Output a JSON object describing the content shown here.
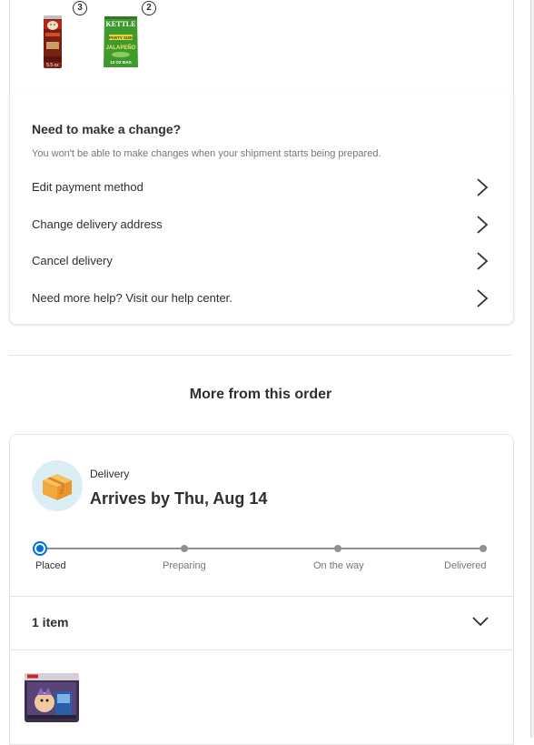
{
  "order_items": [
    {
      "name": "Pringles",
      "quantity": "3",
      "can_text": "5.5 oz"
    },
    {
      "name": "Kettle Jalapeño chips",
      "quantity": "2",
      "bag_brand": "KETTLE",
      "bag_tag": "PARTY SIZE",
      "bag_flavor": "JALAPEÑO",
      "bag_size": "13 OZ BAG"
    }
  ],
  "change": {
    "title": "Need to make a change?",
    "subtitle": "You won't be able to make changes when your shipment starts being prepared.",
    "actions": [
      {
        "label": "Edit payment method"
      },
      {
        "label": "Change delivery address"
      },
      {
        "label": "Cancel delivery"
      },
      {
        "label": "Need more help? Visit our help center."
      }
    ]
  },
  "more_section": {
    "title": "More from this order"
  },
  "delivery": {
    "type_label": "Delivery",
    "arrival": "Arrives by Thu, Aug 14",
    "steps": [
      {
        "label": "Placed",
        "status": "current"
      },
      {
        "label": "Preparing",
        "status": "pending"
      },
      {
        "label": "On the way",
        "status": "pending"
      },
      {
        "label": "Delivered",
        "status": "pending"
      }
    ],
    "item_count": "1 item"
  },
  "colors": {
    "accent_blue": "#0071dc",
    "text": "#2e2f32",
    "muted": "#74767c",
    "track": "#909196",
    "icon_bg": "#dbeef6"
  },
  "icons": [
    "chevron-right-icon",
    "chevron-down-icon",
    "package-box-icon"
  ]
}
